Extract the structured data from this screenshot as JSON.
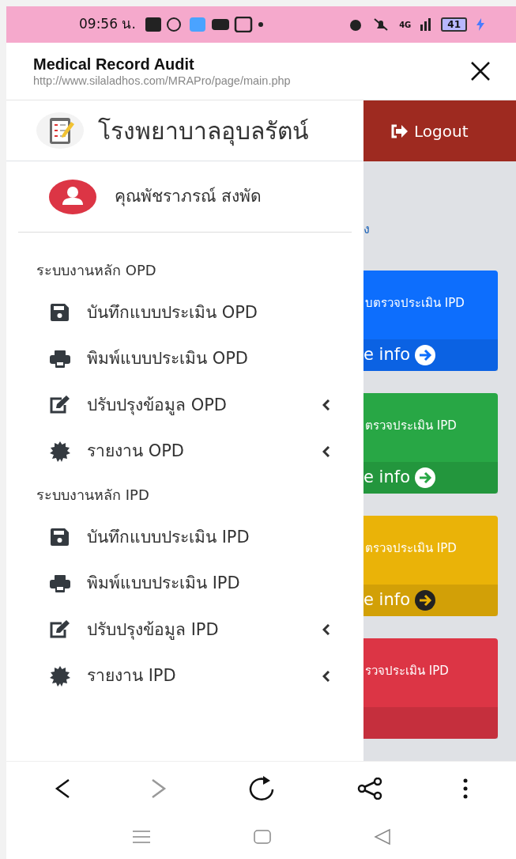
{
  "status_bar": {
    "time": "09:56 น.",
    "network": "4G",
    "battery": "41"
  },
  "browser_header": {
    "title": "Medical Record Audit",
    "url": "http://www.silaladhos.com/MRAPro/page/main.php"
  },
  "drawer": {
    "hospital": "โรงพยาบาลอุบลรัตน์",
    "user": "คุณพัชราภรณ์ สงพัด",
    "menu": [
      {
        "kind": "section",
        "label": "ระบบงานหลัก OPD"
      },
      {
        "kind": "save",
        "label": "บันทึกแบบประเมิน OPD",
        "has_submenu": false
      },
      {
        "kind": "print",
        "label": "พิมพ์แบบประเมิน OPD",
        "has_submenu": false
      },
      {
        "kind": "edit",
        "label": "ปรับปรุงข้อมูล OPD",
        "has_submenu": true
      },
      {
        "kind": "report",
        "label": "รายงาน OPD",
        "has_submenu": true
      },
      {
        "kind": "section",
        "label": "ระบบงานหลัก IPD"
      },
      {
        "kind": "save",
        "label": "บันทึกแบบประเมิน IPD",
        "has_submenu": false
      },
      {
        "kind": "print",
        "label": "พิมพ์แบบประเมิน IPD",
        "has_submenu": false
      },
      {
        "kind": "edit",
        "label": "ปรับปรุงข้อมูล IPD",
        "has_submenu": true
      },
      {
        "kind": "report",
        "label": "รายงาน IPD",
        "has_submenu": true
      }
    ]
  },
  "page": {
    "logout": "Logout",
    "heading_fragment": "ง",
    "cards": [
      {
        "color": "#0d6efd",
        "title": "บตรวจประเมิน IPD",
        "footer": "e info"
      },
      {
        "color": "#28a745",
        "title": "ตรวจประเมิน IPD",
        "footer": "e info"
      },
      {
        "color": "#eab308",
        "title": "ตรวจประเมิน IPD",
        "footer": "e info"
      },
      {
        "color": "#dc3545",
        "title": "รวจประเมิน IPD"
      }
    ]
  }
}
